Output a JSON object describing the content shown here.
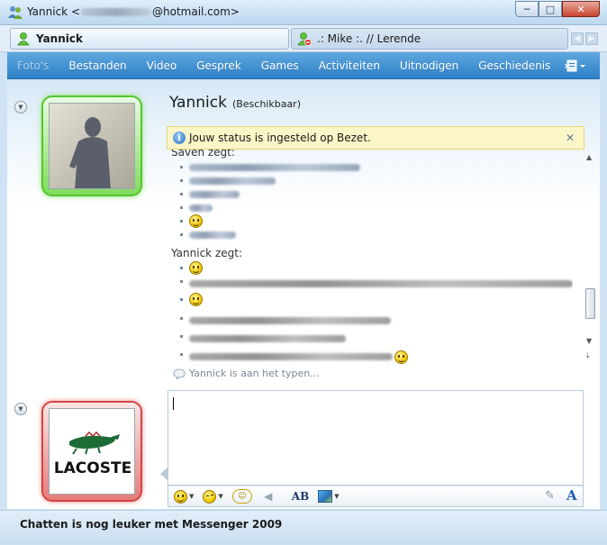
{
  "window": {
    "title_prefix": "Yannick <",
    "title_suffix": "@hotmail.com>",
    "controls": {
      "minimize": "─",
      "maximize": "□",
      "close": "✕"
    }
  },
  "contact_tabs": [
    {
      "label": "Yannick",
      "active": true,
      "status": "online"
    },
    {
      "label": ".: Mike :.  //  Lerende",
      "active": false,
      "status": "busy"
    }
  ],
  "toolbar": {
    "items": [
      "Foto's",
      "Bestanden",
      "Video",
      "Gesprek",
      "Games",
      "Activiteiten",
      "Uitnodigen",
      "Geschiedenis"
    ],
    "more": "»"
  },
  "contact": {
    "name": "Yannick",
    "status": "(Beschikbaar)"
  },
  "infobar": {
    "text": "Jouw status is ingesteld op Bezet.",
    "close": "✕"
  },
  "chat": {
    "sender1": "Saven zegt:",
    "sender2": "Yannick zegt:"
  },
  "typing_indicator": "Yannick is aan het typen...",
  "lower_avatar": {
    "brand": "LACOSTE"
  },
  "footer": "Chatten is nog leuker met Messenger 2009",
  "colors": {
    "toolbar": "#3a8fd3",
    "online": "#56c52e",
    "busy": "#d24545",
    "infobar": "#fbf6c8"
  }
}
